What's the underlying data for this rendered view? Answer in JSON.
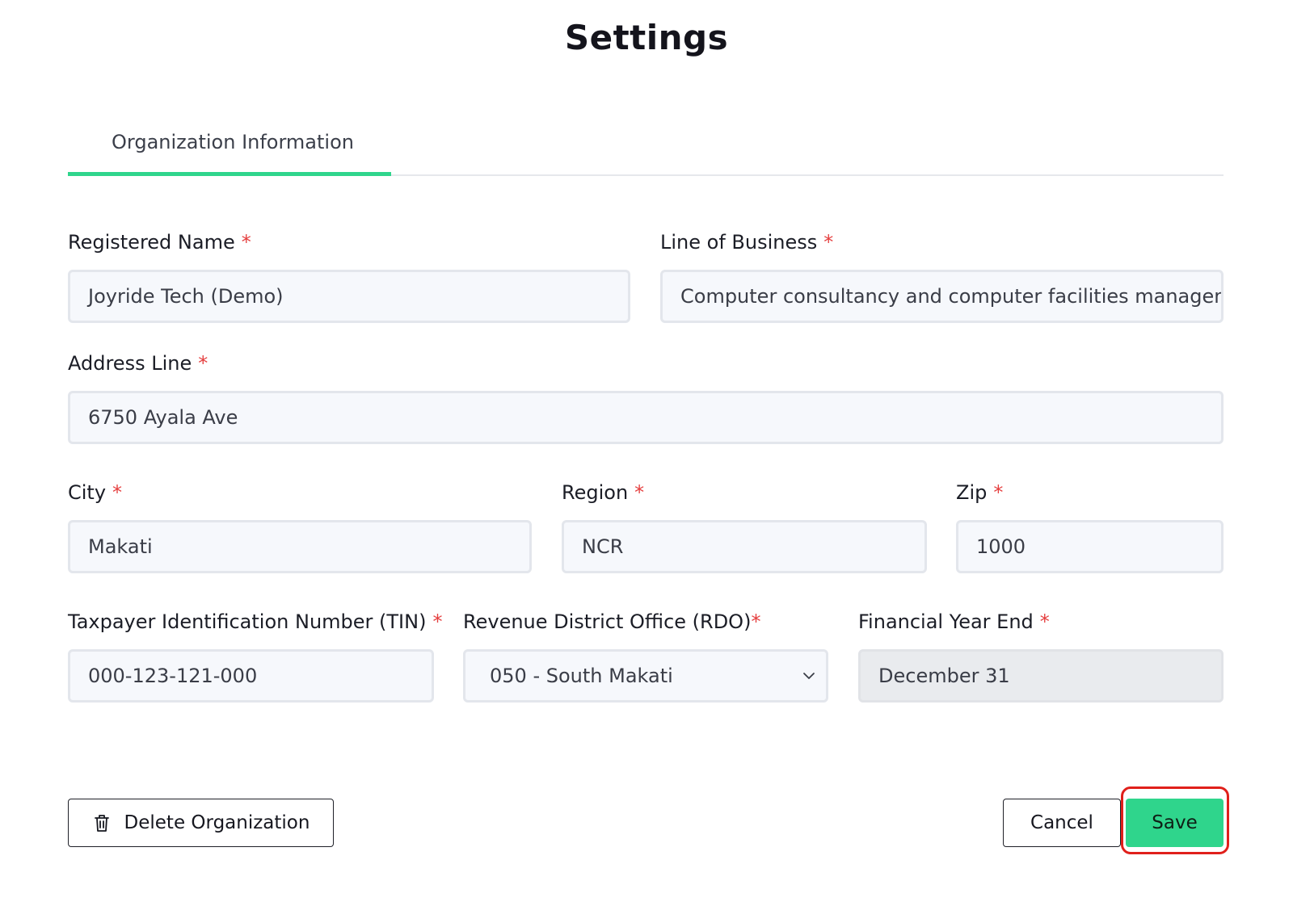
{
  "page": {
    "title": "Settings"
  },
  "tabs": [
    {
      "label": "Organization Information",
      "active": true
    }
  ],
  "form": {
    "registered_name": {
      "label": "Registered Name",
      "value": "Joyride Tech (Demo)"
    },
    "line_of_business": {
      "label": "Line of Business",
      "value": "Computer consultancy and computer facilities managen"
    },
    "address_line": {
      "label": "Address Line",
      "value": "6750 Ayala Ave"
    },
    "city": {
      "label": "City",
      "value": "Makati"
    },
    "region": {
      "label": "Region",
      "value": "NCR"
    },
    "zip": {
      "label": "Zip",
      "value": "1000"
    },
    "tin": {
      "label": "Taxpayer Identification Number (TIN)",
      "value": "000-123-121-000"
    },
    "rdo": {
      "label": "Revenue District Office (RDO)",
      "value": "050 - South Makati"
    },
    "financial_year_end": {
      "label": "Financial Year End",
      "value": "December 31"
    },
    "required_marker": "*"
  },
  "actions": {
    "delete_label": "Delete Organization",
    "cancel_label": "Cancel",
    "save_label": "Save"
  },
  "colors": {
    "accent": "#2fd58c",
    "required": "#e53e3e",
    "highlight": "#e0201b"
  }
}
